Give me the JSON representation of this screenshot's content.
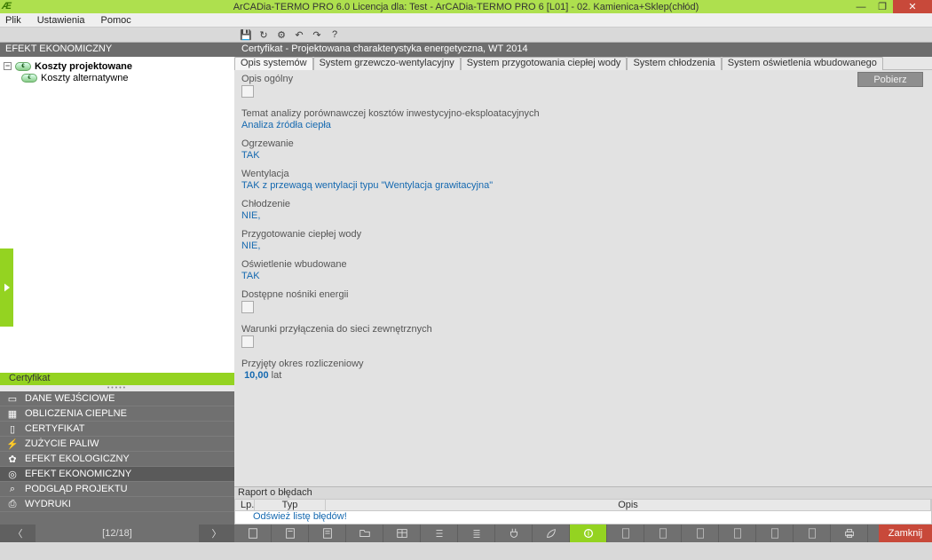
{
  "title": "ArCADia-TERMO PRO 6.0 Licencja dla: Test - ArCADia-TERMO PRO 6 [L01] - 02. Kamienica+Sklep(chłód)",
  "menu": {
    "plik": "Plik",
    "ustawienia": "Ustawienia",
    "pomoc": "Pomoc"
  },
  "left_title": "EFEKT EKONOMICZNY",
  "tree": {
    "item0": "Koszty projektowane",
    "item1": "Koszty alternatywne"
  },
  "cert_bar": "Certyfikat",
  "nav": {
    "n0": "DANE WEJŚCIOWE",
    "n1": "OBLICZENIA CIEPLNE",
    "n2": "CERTYFIKAT",
    "n3": "ZUŻYCIE PALIW",
    "n4": "EFEKT EKOLOGICZNY",
    "n5": "EFEKT EKONOMICZNY",
    "n6": "PODGLĄD PROJEKTU",
    "n7": "WYDRUKI"
  },
  "pager": "[12/18]",
  "right_title": "Certyfikat - Projektowana charakterystyka energetyczna, WT 2014",
  "tabs": {
    "t0": "Opis systemów",
    "t1": "System grzewczo-wentylacyjny",
    "t2": "System przygotowania ciepłej wody",
    "t3": "System chłodzenia",
    "t4": "System oświetlenia wbudowanego"
  },
  "btn_pobierz": "Pobierz",
  "content": {
    "c0": "Opis ogólny",
    "c1": "Temat analizy porównawczej kosztów inwestycyjno-eksploatacyjnych",
    "c1v": "Analiza źródła ciepła",
    "c2": "Ogrzewanie",
    "c2v": "TAK",
    "c3": "Wentylacja",
    "c3v": "TAK z przewagą wentylacji typu \"Wentylacja grawitacyjna\"",
    "c4": "Chłodzenie",
    "c4v": "NIE,",
    "c5": "Przygotowanie ciepłej wody",
    "c5v": "NIE,",
    "c6": "Oświetlenie wbudowane",
    "c6v": "TAK",
    "c7": "Dostępne nośniki energii",
    "c8": "Warunki przyłączenia do sieci zewnętrznych",
    "c9": "Przyjęty okres rozliczeniowy",
    "c9v": "10,00",
    "c9u": "lat"
  },
  "err": {
    "title": "Raport o błędach",
    "h0": "Lp.",
    "h1": "Typ",
    "h2": "Opis",
    "refresh": "Odśwież listę błędów!"
  },
  "close": "Zamknij"
}
